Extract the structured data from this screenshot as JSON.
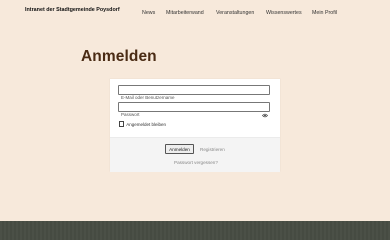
{
  "header": {
    "site_title": "Intranet der Stadtgemeinde Poysdorf"
  },
  "nav": {
    "items": [
      {
        "label": "News"
      },
      {
        "label": "Mitarbeiterwand"
      },
      {
        "label": "Veranstaltungen"
      },
      {
        "label": "Wissenswertes"
      },
      {
        "label": "Mein Profil"
      }
    ]
  },
  "page": {
    "title": "Anmelden"
  },
  "login_form": {
    "username_placeholder": "E-Mail oder Benutzername",
    "password_placeholder": "Passwort",
    "remember_label": "Angemeldet bleiben",
    "submit_label": "Anmelden",
    "register_label": "Registrieren",
    "forgot_label": "Passwort vergessen?",
    "password_toggle_icon": "eye-icon"
  },
  "colors": {
    "background": "#f7e9db",
    "heading": "#4a2b14",
    "footer": "#4b5047"
  }
}
